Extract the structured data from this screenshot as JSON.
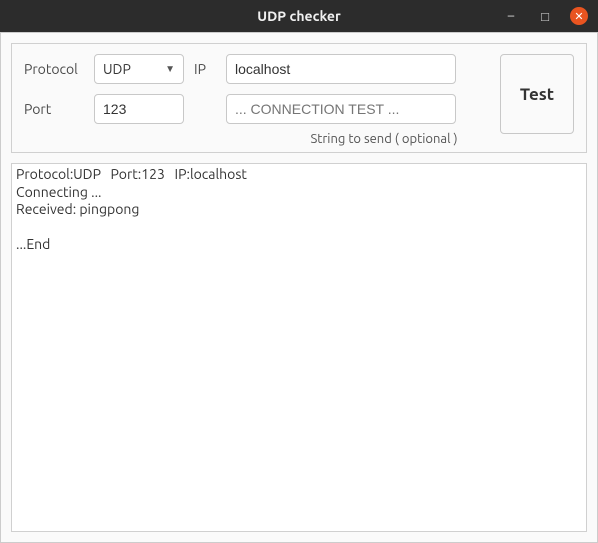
{
  "window": {
    "title": "UDP checker"
  },
  "form": {
    "protocol_label": "Protocol",
    "protocol_value": "UDP",
    "ip_label": "IP",
    "ip_value": "localhost",
    "port_label": "Port",
    "port_value": "123",
    "string_placeholder": "... CONNECTION TEST ...",
    "hint": "String to send ( optional )",
    "test_button": "Test"
  },
  "output": {
    "text": "Protocol:UDP   Port:123   IP:localhost\nConnecting ...\nReceived: pingpong\n\n...End"
  }
}
